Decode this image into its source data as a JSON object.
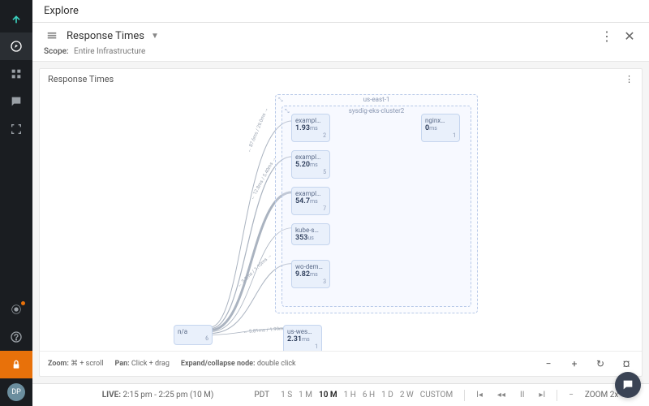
{
  "titlebar": {
    "title": "Explore"
  },
  "header": {
    "dash_icon": "response-times-icon",
    "title": "Response Times",
    "scope_label": "Scope:",
    "scope_value": "Entire Infrastructure"
  },
  "panel": {
    "title": "Response Times",
    "zoom_hint_label": "Zoom:",
    "zoom_hint_value": "⌘ + scroll",
    "pan_hint_label": "Pan:",
    "pan_hint_value": "Click + drag",
    "expand_hint_label": "Expand/collapse node:",
    "expand_hint_value": "double click"
  },
  "topology": {
    "outer_cluster": {
      "label": "us-east-1"
    },
    "inner_cluster": {
      "label": "sysdig-eks-cluster2"
    },
    "nodes": [
      {
        "id": "na",
        "name": "n/a",
        "value": "",
        "unit": "",
        "count": "6"
      },
      {
        "id": "ex1",
        "name": "exampl…",
        "value": "1.93",
        "unit": "ms",
        "count": "2"
      },
      {
        "id": "ex2",
        "name": "exampl…",
        "value": "5.20",
        "unit": "ms",
        "count": "5"
      },
      {
        "id": "ex3",
        "name": "exampl…",
        "value": "54.7",
        "unit": "ms",
        "count": "7"
      },
      {
        "id": "kube",
        "name": "kube-s…",
        "value": "353",
        "unit": "us",
        "count": ""
      },
      {
        "id": "wodem",
        "name": "wo-dem…",
        "value": "9.82",
        "unit": "ms",
        "count": "3"
      },
      {
        "id": "nginx",
        "name": "nginx…",
        "value": "0",
        "unit": "ms",
        "count": "1"
      },
      {
        "id": "uswes",
        "name": "us-wes…",
        "value": "2.31",
        "unit": "ms",
        "count": "1"
      }
    ],
    "edge_labels": [
      "← 87.6ms / 29.0ms →",
      "← 12.8ms / 5.40ms →",
      "← 3.2ms / 1.10ms →",
      "← 5.81ms / 1.99ms →"
    ]
  },
  "timebar": {
    "live_label": "LIVE:",
    "range_text": "2:15 pm - 2:25 pm (10 M)",
    "tz": "PDT",
    "buttons": [
      "1 S",
      "1 M",
      "10 M",
      "1 H",
      "6 H",
      "1 D",
      "2 W",
      "CUSTOM"
    ],
    "active_button": "10 M",
    "zoom_label": "ZOOM 2x"
  },
  "avatar": {
    "initials": "DP"
  }
}
